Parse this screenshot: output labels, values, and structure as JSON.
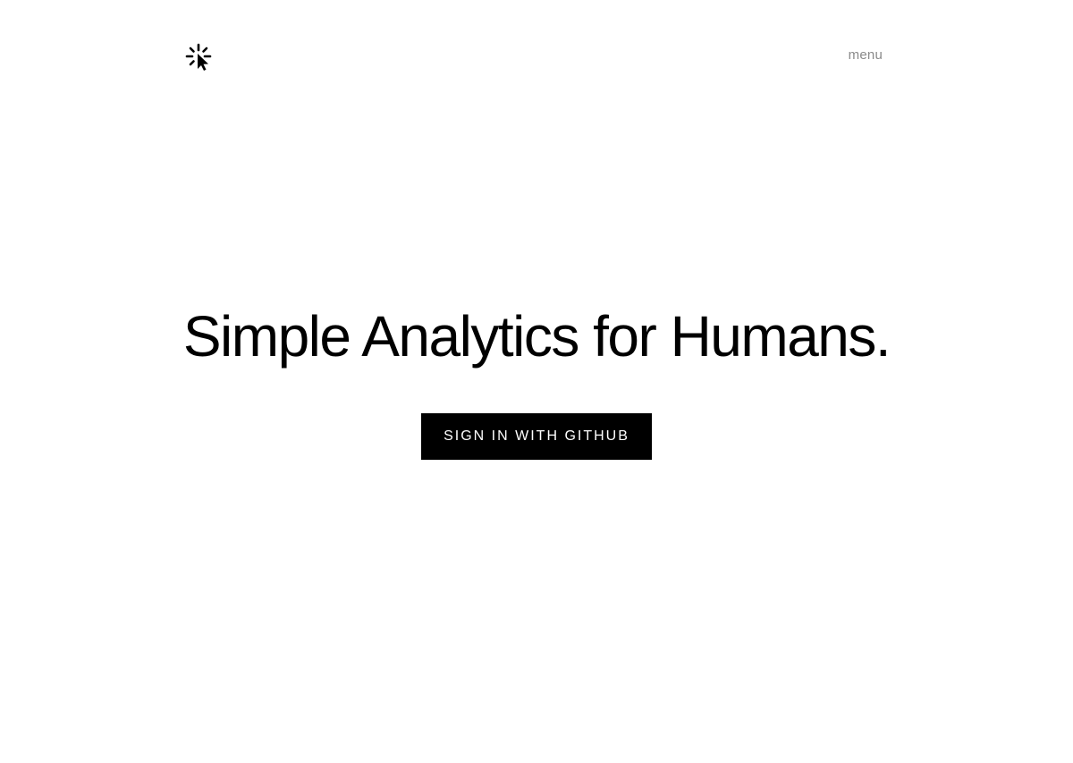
{
  "header": {
    "logo_icon": "cursor-click-icon",
    "menu_label": "menu"
  },
  "hero": {
    "title": "Simple Analytics for Humans.",
    "signin_label": "SIGN IN WITH GITHUB"
  },
  "colors": {
    "background": "#ffffff",
    "text": "#000000",
    "menu_text": "#8a8a8a",
    "button_bg": "#000000",
    "button_text": "#ffffff"
  }
}
